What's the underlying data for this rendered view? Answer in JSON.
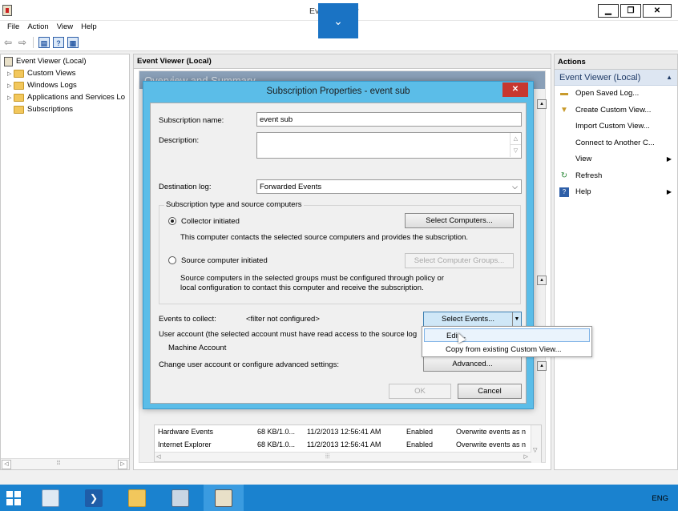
{
  "window": {
    "title": "Event Viewer",
    "min_label": "▁",
    "max_label": "❐",
    "close_label": "✕",
    "overlay_chevron": "⌄"
  },
  "menu": [
    "File",
    "Action",
    "View",
    "Help"
  ],
  "tree": {
    "root": "Event Viewer (Local)",
    "items": [
      "Custom Views",
      "Windows Logs",
      "Applications and Services Lo",
      "Subscriptions"
    ]
  },
  "middle": {
    "header": "Event Viewer (Local)",
    "section_title": "Overview and Summary",
    "rows": [
      {
        "name": "Hardware Events",
        "size": "68 KB/1.0...",
        "modified": "11/2/2013 12:56:41 AM",
        "status": "Enabled",
        "policy": "Overwrite events as n"
      },
      {
        "name": "Internet Explorer",
        "size": "68 KB/1.0...",
        "modified": "11/2/2013 12:56:41 AM",
        "status": "Enabled",
        "policy": "Overwrite events as n"
      }
    ]
  },
  "actions": {
    "header": "Actions",
    "section": "Event Viewer (Local)",
    "items": [
      {
        "label": "Open Saved Log...",
        "icon": "folder-icon",
        "has_submenu": false
      },
      {
        "label": "Create Custom View...",
        "icon": "filter-icon",
        "has_submenu": false
      },
      {
        "label": "Import Custom View...",
        "icon": "",
        "has_submenu": false
      },
      {
        "label": "Connect to Another C...",
        "icon": "",
        "has_submenu": false
      },
      {
        "label": "View",
        "icon": "",
        "has_submenu": true
      },
      {
        "label": "Refresh",
        "icon": "refresh-icon",
        "has_submenu": false
      },
      {
        "label": "Help",
        "icon": "help-icon",
        "has_submenu": true
      }
    ]
  },
  "dialog": {
    "title": "Subscription Properties - event sub",
    "subscription_name_label": "Subscription name:",
    "subscription_name_value": "event sub",
    "description_label": "Description:",
    "description_value": "",
    "destination_log_label": "Destination log:",
    "destination_log_value": "Forwarded Events",
    "group_title": "Subscription type and source computers",
    "collector_label": "Collector initiated",
    "collector_desc": "This computer contacts the selected source computers and provides the subscription.",
    "select_computers": "Select Computers...",
    "source_label": "Source computer initiated",
    "select_groups": "Select Computer Groups...",
    "source_desc_1": "Source computers in the selected groups must be configured through policy or",
    "source_desc_2": "local configuration to contact this computer and receive the subscription.",
    "events_label": "Events to collect:",
    "events_value": "<filter not configured>",
    "select_events": "Select Events...",
    "user_account_label": "User account (the selected account must have read access to the source log",
    "user_account_value": "Machine Account",
    "change_label": "Change user account or configure advanced settings:",
    "advanced": "Advanced...",
    "ok": "OK",
    "cancel": "Cancel"
  },
  "dropdown": [
    "Edit...",
    "Copy from existing Custom View..."
  ],
  "taskbar": {
    "lang": "ENG"
  },
  "colors": {
    "dialog_frame": "#5bbde8",
    "taskbar": "#1a82cf",
    "close_red": "#c7372f"
  }
}
